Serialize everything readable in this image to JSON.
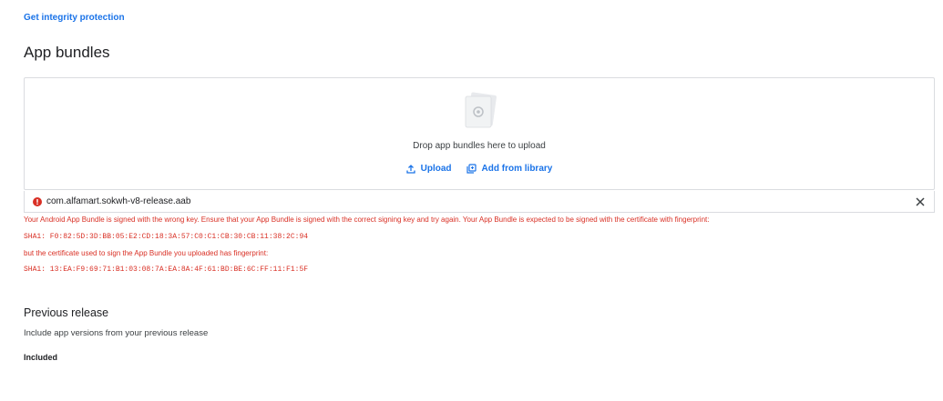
{
  "header": {
    "integrity_link": "Get integrity protection",
    "section_title": "App bundles"
  },
  "dropzone": {
    "text": "Drop app bundles here to upload",
    "upload_label": "Upload",
    "library_label": "Add from library"
  },
  "file": {
    "name": "com.alfamart.sokwh-v8-release.aab",
    "status": "error"
  },
  "error": {
    "message": "Your Android App Bundle is signed with the wrong key. Ensure that your App Bundle is signed with the correct signing key and try again. Your App Bundle is expected to be signed with the certificate with fingerprint:",
    "expected_sha": "SHA1: F0:82:5D:3D:BB:05:E2:CD:18:3A:57:C0:C1:CB:30:CB:11:38:2C:94",
    "uploaded_intro": "but the certificate used to sign the App Bundle you uploaded has fingerprint:",
    "uploaded_sha": "SHA1: 13:EA:F9:69:71:B1:03:08:7A:EA:8A:4F:61:BD:BE:6C:FF:11:F1:5F"
  },
  "previous_release": {
    "title": "Previous release",
    "subtitle": "Include app versions from your previous release",
    "status": "Included"
  },
  "colors": {
    "link": "#1a73e8",
    "error": "#d93025",
    "border": "#dadce0"
  }
}
